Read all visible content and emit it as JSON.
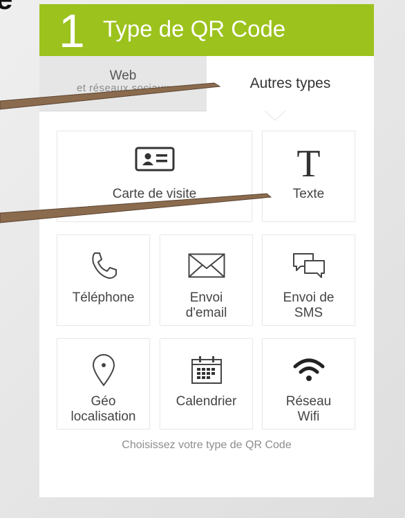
{
  "corner_glyph": "e",
  "header": {
    "step": "1",
    "title": "Type de QR Code",
    "accent_color": "#9cc21d"
  },
  "tabs": [
    {
      "label": "Web",
      "sublabel": "et réseaux sociaux",
      "active": false
    },
    {
      "label": "Autres types",
      "active": true
    }
  ],
  "tiles": {
    "business_card": {
      "label": "Carte de visite",
      "icon": "business-card-icon"
    },
    "text": {
      "label": "Texte",
      "icon": "text-t-icon"
    },
    "phone": {
      "label": "Téléphone",
      "icon": "phone-icon"
    },
    "email": {
      "line1": "Envoi",
      "line2": "d'email",
      "icon": "envelope-icon"
    },
    "sms": {
      "line1": "Envoi de",
      "line2": "SMS",
      "icon": "chat-bubbles-icon"
    },
    "geo": {
      "line1": "Géo",
      "line2": "localisation",
      "icon": "map-pin-icon"
    },
    "calendar": {
      "label": "Calendrier",
      "icon": "calendar-icon"
    },
    "wifi": {
      "line1": "Réseau",
      "line2": "Wifi",
      "icon": "wifi-icon"
    }
  },
  "footer_note": "Choisissez votre type de QR Code"
}
